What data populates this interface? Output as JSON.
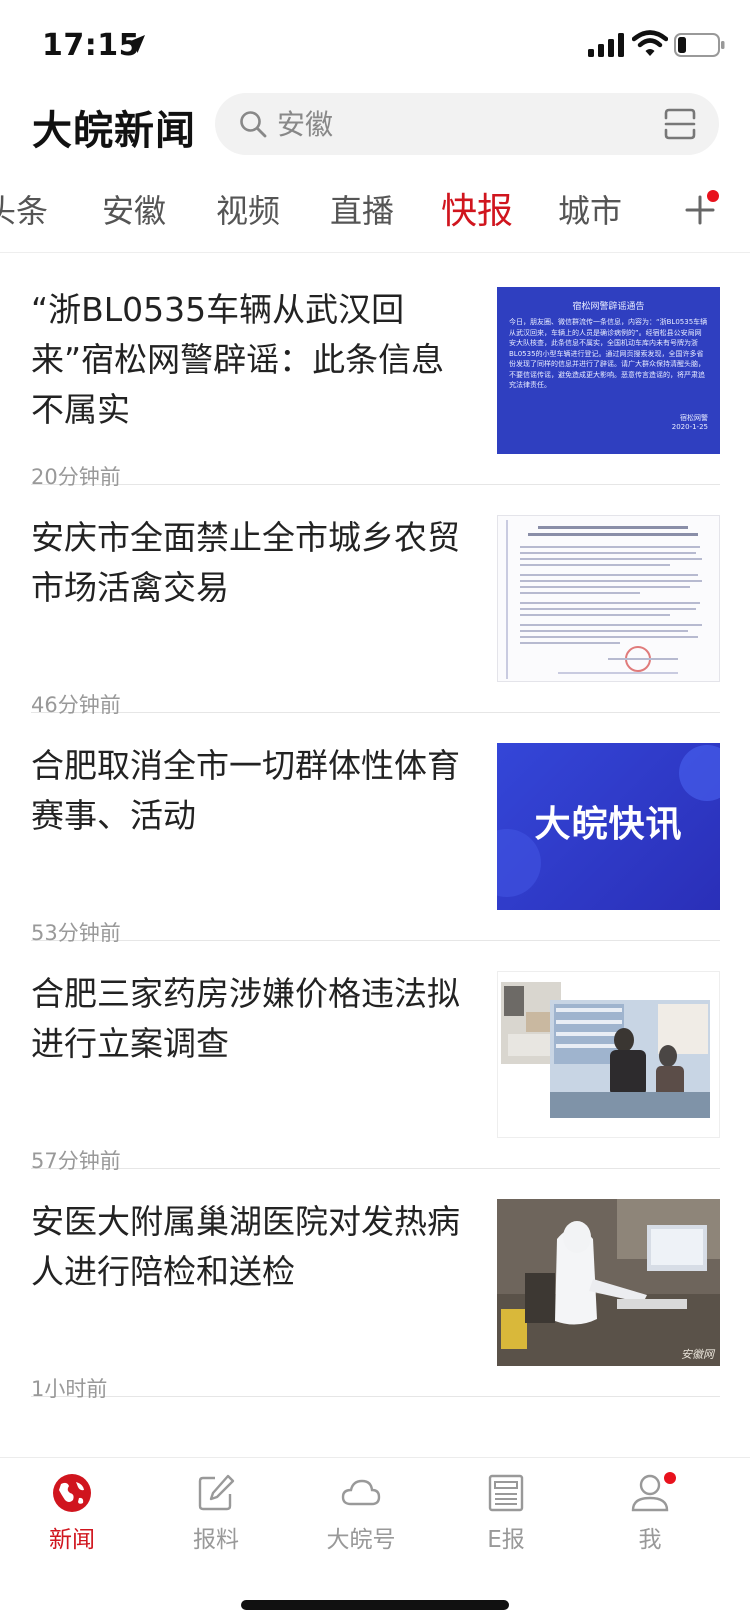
{
  "status": {
    "time": "17:15"
  },
  "header": {
    "app_title": "大皖新闻",
    "search_placeholder": "安徽"
  },
  "tabs": [
    {
      "label": "头条"
    },
    {
      "label": "安徽"
    },
    {
      "label": "视频"
    },
    {
      "label": "直播"
    },
    {
      "label": "快报",
      "active": true
    },
    {
      "label": "城市"
    }
  ],
  "news": [
    {
      "title": "“浙BL0535车辆从武汉回来”宿松网警辟谣：此条信息不属实",
      "time": "20分钟前",
      "thumb": {
        "heading": "宿松网警辟谣通告",
        "body": "今日，朋友圈、微信群流传一条信息，内容为：“浙BL0535车辆从武汉回来，车辆上的人员是确诊病例的”。经宿松县公安局网安大队核查，此条信息不属实，全国机动车库内未有号牌为浙BL0535的小型车辆进行登记。通过网页搜索发现，全国许多省份发现了同样的信息并进行了辟谣。请广大群众保持清醒头脑，不要信谣传谣，避免造成更大影响。恶意传言造谣的，将严肃追究法律责任。",
        "sign": "宿松网警",
        "date": "2020-1-25"
      }
    },
    {
      "title": "安庆市全面禁止全市城乡农贸市场活禽交易",
      "time": "46分钟前"
    },
    {
      "title": "合肥取消全市一切群体性体育赛事、活动",
      "time": "53分钟前",
      "thumb": {
        "brand": "大皖快讯"
      }
    },
    {
      "title": "合肥三家药房涉嫌价格违法拟进行立案调查",
      "time": "57分钟前"
    },
    {
      "title": "安医大附属巢湖医院对发热病人进行陪检和送检",
      "time": "1小时前",
      "thumb": {
        "watermark": "安徽网"
      }
    }
  ],
  "bottom_nav": [
    {
      "label": "新闻",
      "icon": "globe-icon",
      "active": true
    },
    {
      "label": "报料",
      "icon": "edit-icon"
    },
    {
      "label": "大皖号",
      "icon": "cloud-icon"
    },
    {
      "label": "E报",
      "icon": "newspaper-icon"
    },
    {
      "label": "我",
      "icon": "user-icon",
      "badge": true
    }
  ],
  "colors": {
    "accent": "#d0151e",
    "badge": "#e8121d",
    "thumb_blue": "#2f3fc0"
  }
}
